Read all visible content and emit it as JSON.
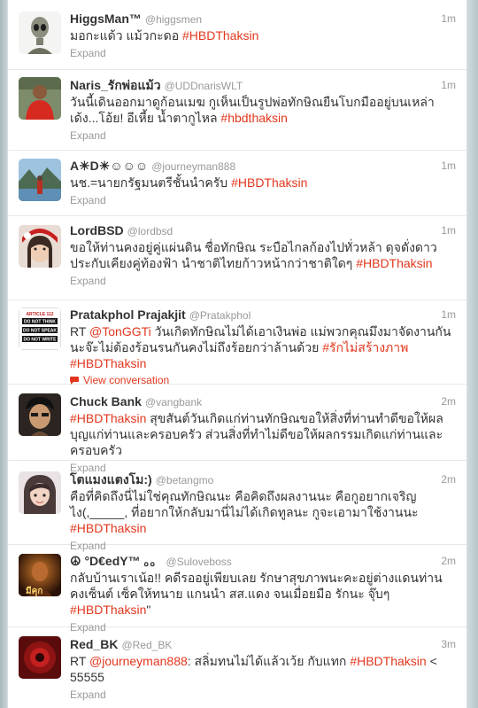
{
  "tweets": [
    {
      "fullname": "HiggsMan™",
      "username": "@higgsmen",
      "time": "1m",
      "text_parts": [
        {
          "t": "มอกะแด้ว แม้วกะดอ "
        },
        {
          "t": "#HBDThaksin",
          "link": true
        }
      ],
      "action": "Expand"
    },
    {
      "fullname": "Naris_รักพ่อแม้ว",
      "username": "@UDDnarisWLT",
      "time": "1m",
      "text_parts": [
        {
          "t": "วันนี้เดินออกมาดูก้อนเมฆ กูเห็นเป็นรูปพ่อทักษิณยืนโบกมืออยู่บนเหล่าเด้ง...โอ้ย! อีเหี้ย น้ำตากูไหล "
        },
        {
          "t": "#hbdthaksin",
          "link": true
        }
      ],
      "action": "Expand"
    },
    {
      "fullname": "A☀D☀☺☺☺",
      "username": "@journeyman888",
      "time": "1m",
      "text_parts": [
        {
          "t": "นช.=นายกรัฐมนตรีชั้นนำครับ "
        },
        {
          "t": "#HBDThaksin",
          "link": true
        }
      ],
      "action": "Expand"
    },
    {
      "fullname": "LordBSD",
      "username": "@lordbsd",
      "time": "1m",
      "text_parts": [
        {
          "t": "ขอให้ท่านคงอยู่คู่แผ่นดิน ชื่อทักษิณ ระบือไกลก้องไปทั่วหล้า ดุจดั่งดาวประกับเคียงคู่ท้องฟ้า นำชาติไทยก้าวหน้ากว่าชาติใดๆ "
        },
        {
          "t": "#HBDThaksin",
          "link": true
        }
      ],
      "action": "Expand"
    },
    {
      "fullname": "Pratakphol Prajakjit",
      "username": "@Pratakphol",
      "time": "1m",
      "text_parts": [
        {
          "t": "RT "
        },
        {
          "t": "@TonGGTi",
          "link": true
        },
        {
          "t": " วันเกิดทักษิณไม่ได้เอาเงินพ่อ แม่พวกคุณมึงมาจัดงานกันนะจ๊ะไม่ต้องร้อนรนกันคงไม่ถึงร้อยกว่าล้านด้วย "
        },
        {
          "t": "#รักไม่สร้างภาพ",
          "link": true
        },
        {
          "t": " "
        },
        {
          "t": "#HBDThaksin",
          "link": true
        }
      ],
      "action": "View conversation",
      "action_is_link": true
    },
    {
      "fullname": "Chuck Bank",
      "username": "@vangbank",
      "time": "2m",
      "text_parts": [
        {
          "t": "#HBDThaksin",
          "link": true
        },
        {
          "t": " สุขสันต์วันเกิดแก่ท่านทักษิณขอให้สิ่งที่ท่านทำดีขอให้ผลบุญแก่ท่านและครอบครัว ส่วนสิ่งที่ทำไม่ดีขอให้ผลกรรมเกิดแก่ท่านและครอบครัว"
        }
      ],
      "action": "Expand"
    },
    {
      "fullname": "โตแมงแตงโม:)",
      "username": "@betangmo",
      "time": "2m",
      "text_parts": [
        {
          "t": "คือที่คิดถึงนี่ไม่ใช่คุณทักษิณนะ คือคิดถึงผลงานนะ คือกูอยากเจริญไง(,_____, ที่อยากให้กลับมานี่ไม่ได้เกิดทูลนะ กูจะเอามาใช้งานนะ "
        },
        {
          "t": "#HBDThaksin",
          "link": true
        }
      ],
      "action": "Expand"
    },
    {
      "fullname": "☮ °D€edY™ 。。",
      "username": "@Suloveboss",
      "time": "2m",
      "text_parts": [
        {
          "t": "กลับบ้านเราเน้อ!! คดีรออยู่เพียบเลย รักษาสุขภาพนะคะอยู่ต่างแดนท่านคงเซ็นต์ เซ็คให้ทนาย แกนนำ สส.แดง จนเมื่อยมือ รักนะ จุ๊บๆ "
        },
        {
          "t": "#HBDThaksin",
          "link": true
        },
        {
          "t": "\""
        }
      ],
      "action": "Expand"
    },
    {
      "fullname": "Red_BK",
      "username": "@Red_BK",
      "time": "3m",
      "text_parts": [
        {
          "t": "RT "
        },
        {
          "t": "@journeyman888",
          "link": true
        },
        {
          "t": ": สลิ่มทนไม่ได้แล้วเว้ย กับแทก "
        },
        {
          "t": "#HBDThaksin",
          "link": true
        },
        {
          "t": " < 55555"
        }
      ],
      "action": "Expand"
    }
  ],
  "avatar_texts": {
    "pratakphol": [
      "ARTICLE 112",
      "DO NOT THINK",
      "DO NOT SPEAK",
      "DO NOT WRITE"
    ],
    "suloveboss": "มีคุก"
  },
  "colors": {
    "link": "#e2371e",
    "meta": "#999999",
    "text": "#333333"
  },
  "icons": {
    "conversation": "speech-bubble-icon"
  }
}
